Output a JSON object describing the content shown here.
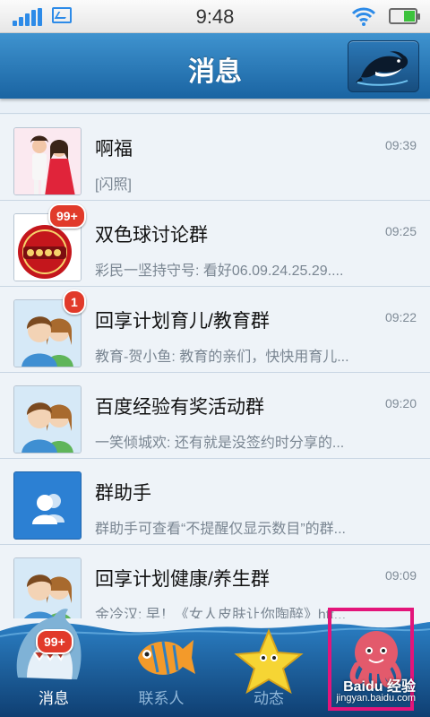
{
  "status_bar": {
    "time": "9:48"
  },
  "header": {
    "title": "消息"
  },
  "messages": [
    {
      "name": "啊福",
      "time": "09:39",
      "preview": "[闪照]",
      "badge": ""
    },
    {
      "name": "双色球讨论群",
      "time": "09:25",
      "preview": "彩民一坚持守号: 看好06.09.24.25.29....",
      "badge": "99+"
    },
    {
      "name": "回享计划育儿/教育群",
      "time": "09:22",
      "preview": "教育-贺小鱼: 教育的亲们，快快用育儿...",
      "badge": "1"
    },
    {
      "name": "百度经验有奖活动群",
      "time": "09:20",
      "preview": "一笑倾城欢: 还有就是没签约时分享的...",
      "badge": ""
    },
    {
      "name": "群助手",
      "time": "",
      "preview": "群助手可查看“不提醒仅显示数目”的群...",
      "badge": ""
    },
    {
      "name": "回享计划健康/养生群",
      "time": "09:09",
      "preview": "金冷汉: 早！《女人皮肤让你陶醉》htt...",
      "badge": ""
    }
  ],
  "bottom_nav": {
    "tabs": [
      {
        "label": "消息",
        "badge": "99+"
      },
      {
        "label": "联系人"
      },
      {
        "label": "动态"
      },
      {
        "label": ""
      }
    ]
  },
  "watermark": {
    "brand": "Baidu 经验",
    "url": "jingyan.baidu.com"
  },
  "colors": {
    "header": "#2a7bbd",
    "badge": "#e13a2a",
    "highlight": "#e3157a"
  }
}
